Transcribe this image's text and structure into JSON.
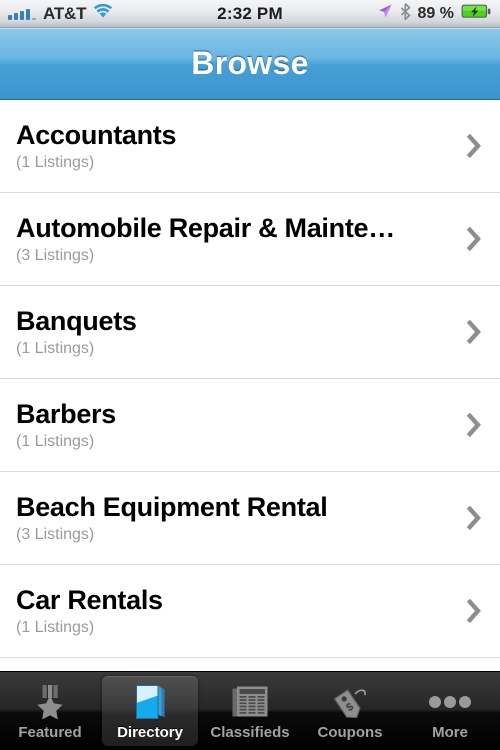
{
  "status_bar": {
    "carrier": "AT&T",
    "signal_bars_filled": 4,
    "signal_bars_total": 5,
    "wifi_icon": "wifi-icon",
    "time": "2:32 PM",
    "location_icon": "location-arrow-icon",
    "bluetooth_icon": "bluetooth-icon",
    "battery_percent": "89 %",
    "battery_state": "charging",
    "battery_color": "#4cd21c"
  },
  "nav_bar": {
    "title": "Browse",
    "gradient_top": "#8cc9ea",
    "gradient_bottom": "#3c95cf"
  },
  "list": {
    "rows": [
      {
        "title": "Accountants",
        "subtitle": "(1 Listings)",
        "accessory": "chevron-right-icon"
      },
      {
        "title": "Automobile Repair & Mainte…",
        "subtitle": "(3 Listings)",
        "accessory": "chevron-right-icon"
      },
      {
        "title": "Banquets",
        "subtitle": "(1 Listings)",
        "accessory": "chevron-right-icon"
      },
      {
        "title": "Barbers",
        "subtitle": "(1 Listings)",
        "accessory": "chevron-right-icon"
      },
      {
        "title": "Beach Equipment Rental",
        "subtitle": "(3 Listings)",
        "accessory": "chevron-right-icon"
      },
      {
        "title": "Car Rentals",
        "subtitle": "(1 Listings)",
        "accessory": "chevron-right-icon"
      }
    ],
    "separator_color": "#dcdcdc",
    "title_color": "#000000",
    "subtitle_color": "#9b9b9b"
  },
  "tab_bar": {
    "selected_index": 1,
    "items": [
      {
        "label": "Featured",
        "icon": "medal-star-icon"
      },
      {
        "label": "Directory",
        "icon": "blue-book-icon"
      },
      {
        "label": "Classifieds",
        "icon": "newspaper-icon"
      },
      {
        "label": "Coupons",
        "icon": "price-tag-icon"
      },
      {
        "label": "More",
        "icon": "three-dots-icon"
      }
    ],
    "label_color": "#a2a2a2",
    "selected_label_color": "#ffffff"
  }
}
